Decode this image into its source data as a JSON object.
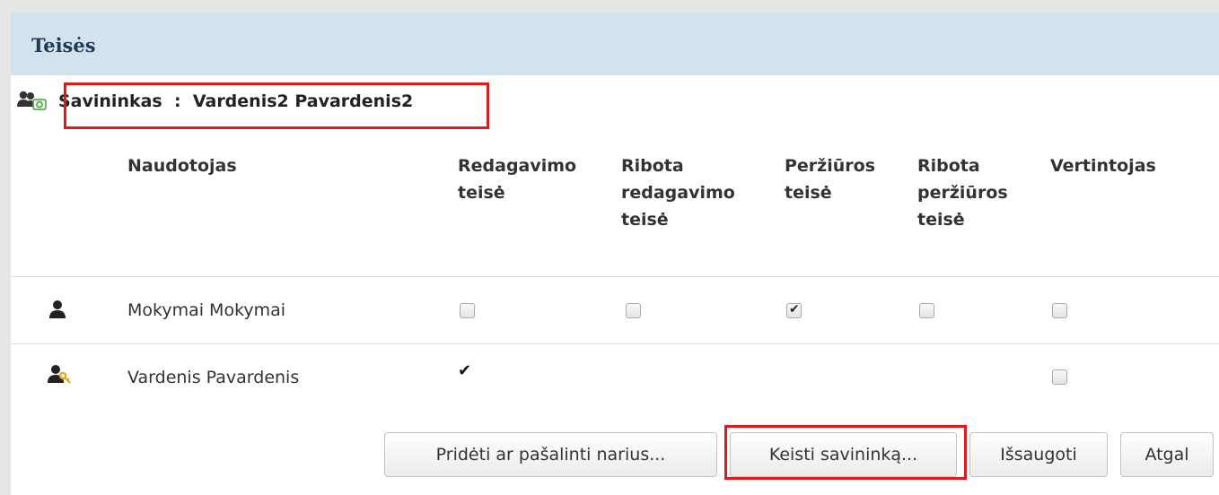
{
  "panel": {
    "title": "Teisės"
  },
  "owner": {
    "label": "Savininkas",
    "separator": ":",
    "name": "Vardenis2 Pavardenis2"
  },
  "table": {
    "headers": [
      "Naudotojas",
      "Redagavimo\nteisė",
      "Ribota\nredagavimo\nteisė",
      "Peržiūros\nteisė",
      "Ribota\nperžiūros\nteisė",
      "Vertintojas"
    ],
    "rows": [
      {
        "icon": "user-icon",
        "name": "Mokymai Mokymai",
        "edit": false,
        "limited_edit": false,
        "view": true,
        "limited_view": false,
        "evaluator": false
      },
      {
        "icon": "user-key-icon",
        "name": "Vardenis Pavardenis",
        "edit_mark": "✔",
        "evaluator": false
      }
    ]
  },
  "buttons": {
    "add_remove": "Pridėti ar pašalinti narius...",
    "change_owner": "Keisti savininką...",
    "save": "Išsaugoti",
    "back": "Atgal"
  },
  "colors": {
    "header_bg": "#d2e3ee",
    "title": "#1f3a56",
    "highlight": "#e11b1b"
  }
}
